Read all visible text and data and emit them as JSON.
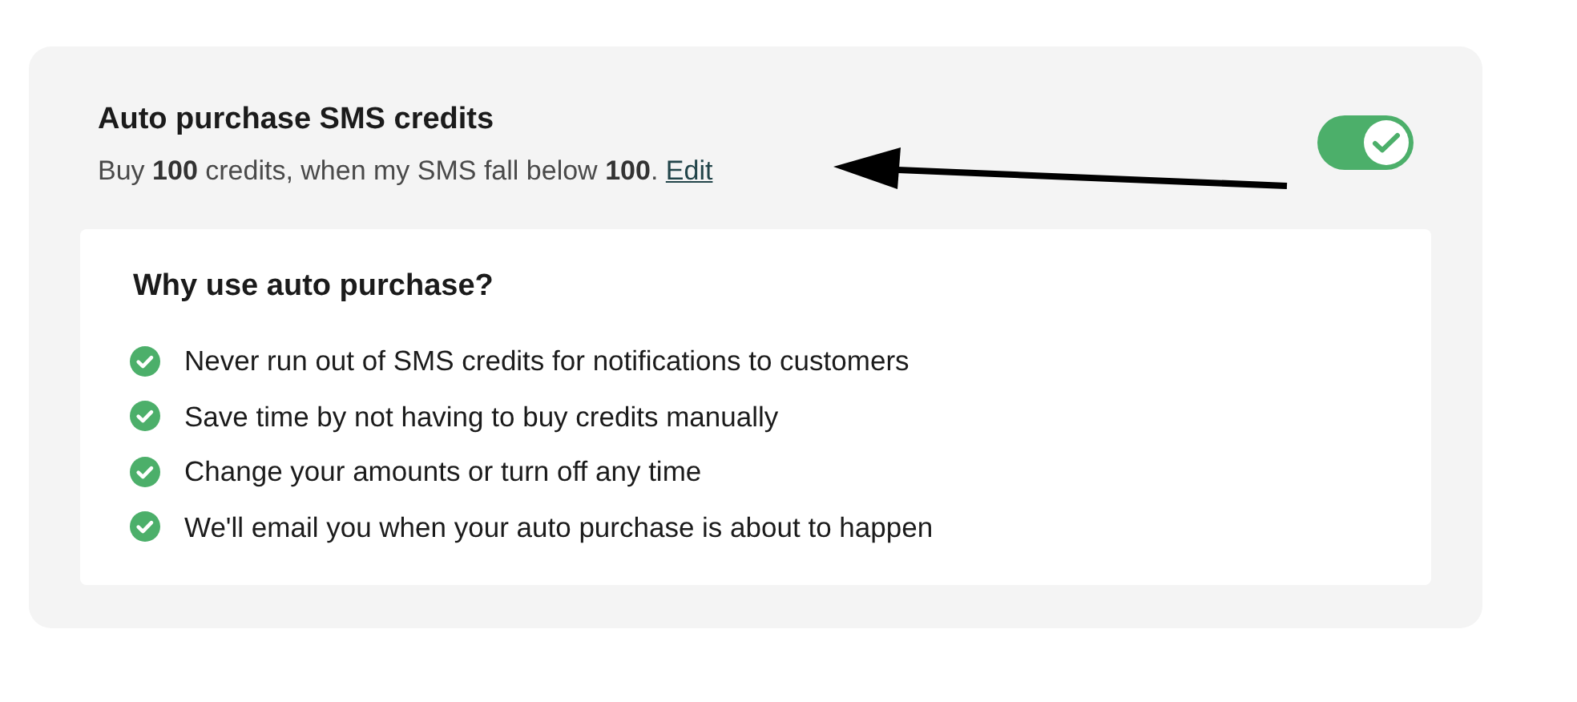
{
  "setting": {
    "title": "Auto purchase SMS credits",
    "description": "Buy **100** credits, when my SMS fall below **100**.",
    "link": "Edit",
    "toggle": {
      "on": true
    }
  },
  "info": {
    "heading": "Why use auto purchase?",
    "items": [
      {
        "text": "Never run out of SMS credits for notifications to customers"
      },
      {
        "text": "Save time by not having to buy credits manually"
      },
      {
        "text": "Change your amounts or turn off any time"
      },
      {
        "text": "We'll email you when your auto purchase is about to happen"
      }
    ]
  }
}
